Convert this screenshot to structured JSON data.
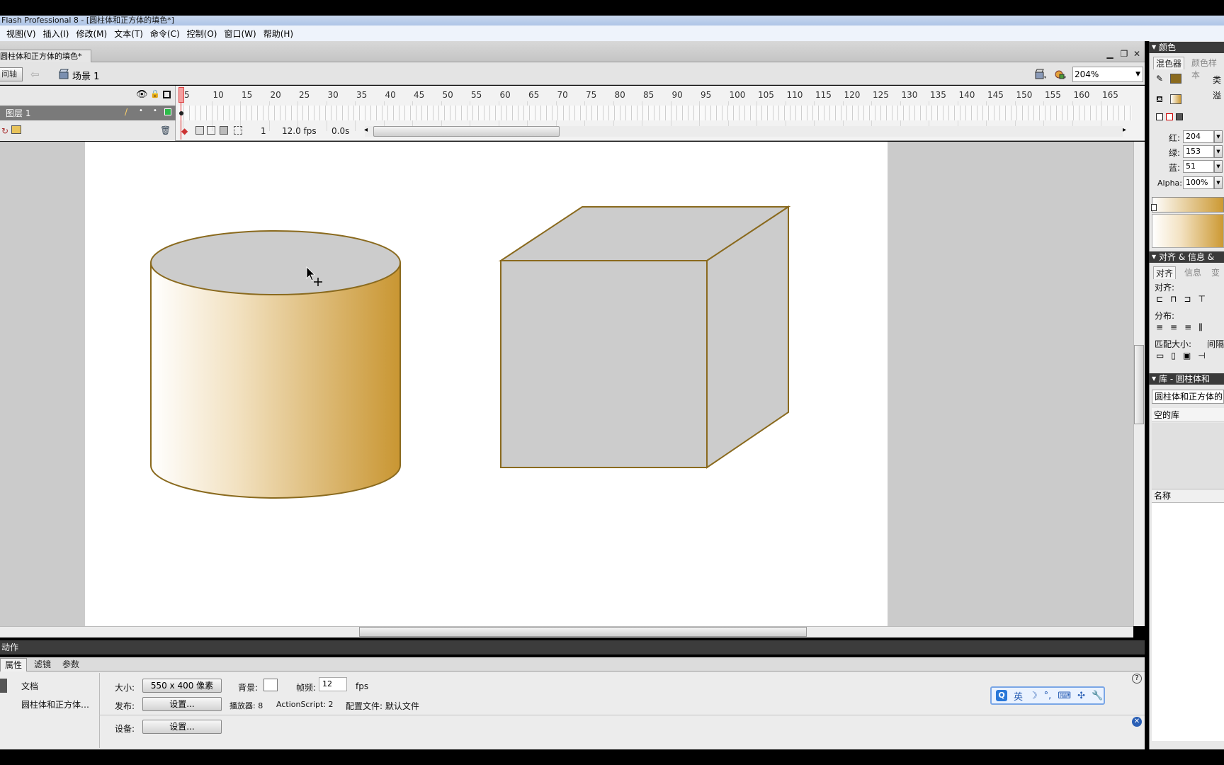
{
  "window": {
    "title": "Flash Professional 8 - [圆柱体和正方体的填色*]"
  },
  "menu": [
    "视图(V)",
    "插入(I)",
    "修改(M)",
    "文本(T)",
    "命令(C)",
    "控制(O)",
    "窗口(W)",
    "帮助(H)"
  ],
  "document": {
    "tab_label": "圆柱体和正方体的填色*"
  },
  "editbar": {
    "timeline_btn": "间轴",
    "scene": "场景 1",
    "zoom": "204%"
  },
  "timeline": {
    "layer": "图层 1",
    "ticks": [
      "5",
      "10",
      "15",
      "20",
      "25",
      "30",
      "35",
      "40",
      "45",
      "50",
      "55",
      "60",
      "65",
      "70",
      "75",
      "80",
      "85",
      "90",
      "95",
      "100",
      "105",
      "110",
      "115",
      "120",
      "125",
      "130",
      "135",
      "140",
      "145",
      "150",
      "155",
      "160",
      "165"
    ],
    "current_frame": "1",
    "frame_rate": "12.0 fps",
    "elapsed": "0.0s"
  },
  "action_bar": "动作",
  "properties": {
    "tabs": [
      "属性",
      "滤镜",
      "参数"
    ],
    "type": "文档",
    "doc_name": "圆柱体和正方体…",
    "size_label": "大小:",
    "size_btn": "550 x 400 像素",
    "bg_label": "背景:",
    "fps_label": "帧频:",
    "fps_value": "12",
    "fps_unit": "fps",
    "publish_label": "发布:",
    "publish_btn": "设置...",
    "player": "播放器: 8",
    "actionscript": "ActionScript: 2",
    "profile": "配置文件: 默认文件",
    "device_label": "设备:",
    "device_btn": "设置..."
  },
  "ime": {
    "mode": "英",
    "glyphs": [
      "☽",
      "°,",
      "⌨",
      "✣",
      "🔧"
    ]
  },
  "color_panel": {
    "title": "颜色",
    "tabs": [
      "混色器",
      "颜色样本"
    ],
    "type_label": "类",
    "overflow_label": "溢",
    "red_label": "红:",
    "red": "204",
    "green_label": "绿:",
    "green": "153",
    "blue_label": "蓝:",
    "blue": "51",
    "alpha_label": "Alpha:",
    "alpha": "100%",
    "gradient_start": "#ffffff",
    "gradient_end": "#cc9933"
  },
  "align_panel": {
    "title": "对齐 & 信息 &",
    "tabs": [
      "对齐",
      "信息",
      "变"
    ],
    "align_label": "对齐:",
    "distribute_label": "分布:",
    "match_label": "匹配大小:",
    "space_label": "间隔"
  },
  "library_panel": {
    "title": "库 - 圆柱体和",
    "doc_select": "圆柱体和正方体的",
    "empty": "空的库",
    "name_col": "名称"
  },
  "colors": {
    "stroke": "#8a6a1e",
    "shape_fill": "#cccccc",
    "gold": "#cc9933"
  }
}
